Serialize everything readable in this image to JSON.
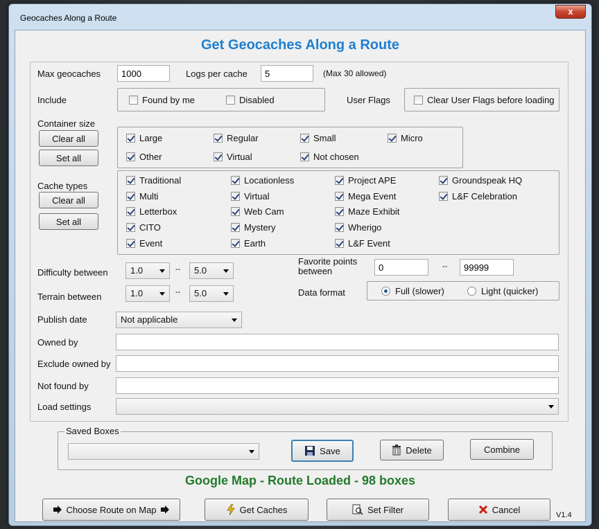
{
  "window": {
    "title": "Geocaches Along a Route",
    "close_glyph": "x"
  },
  "heading": "Get Geocaches Along a Route",
  "fields": {
    "max_geocaches": {
      "label": "Max geocaches",
      "value": "1000"
    },
    "logs_per_cache": {
      "label": "Logs per cache",
      "value": "5",
      "note": "(Max 30 allowed)"
    }
  },
  "include": {
    "label": "Include",
    "found_by_me": "Found by me",
    "disabled": "Disabled"
  },
  "user_flags": {
    "label": "User Flags",
    "clear": "Clear User Flags before loading"
  },
  "container": {
    "label": "Container size",
    "clear_all": "Clear all",
    "set_all": "Set all",
    "items": [
      "Large",
      "Regular",
      "Small",
      "Micro",
      "Other",
      "Virtual",
      "Not chosen"
    ]
  },
  "cache_types": {
    "label": "Cache types",
    "clear_all": "Clear all",
    "set_all": "Set all",
    "items": [
      "Traditional",
      "Locationless",
      "Project APE",
      "Groundspeak HQ",
      "Multi",
      "Virtual",
      "Mega Event",
      "L&F Celebration",
      "Letterbox",
      "Web Cam",
      "Maze Exhibit",
      "CITO",
      "Mystery",
      "Wherigo",
      "Event",
      "Earth",
      "L&F Event"
    ]
  },
  "difficulty": {
    "label": "Difficulty between",
    "from": "1.0",
    "to": "5.0",
    "dash": "--"
  },
  "terrain": {
    "label": "Terrain between",
    "from": "1.0",
    "to": "5.0",
    "dash": "--"
  },
  "favorite": {
    "label": "Favorite points between",
    "from": "0",
    "to": "99999",
    "dash": "--"
  },
  "data_format": {
    "label": "Data format",
    "full": "Full (slower)",
    "light": "Light (quicker)"
  },
  "publish": {
    "label": "Publish date",
    "value": "Not applicable"
  },
  "owned_by": {
    "label": "Owned by"
  },
  "exclude_owned": {
    "label": "Exclude owned by"
  },
  "not_found_by": {
    "label": "Not found by"
  },
  "load_settings": {
    "label": "Load settings"
  },
  "saved_boxes": {
    "label": "Saved Boxes",
    "save": "Save",
    "delete": "Delete",
    "combine": "Combine"
  },
  "status": "Google Map - Route Loaded - 98 boxes",
  "buttons": {
    "choose_route": "Choose Route on Map",
    "get_caches": "Get Caches",
    "set_filter": "Set Filter",
    "cancel": "Cancel"
  },
  "version": "V1.4"
}
